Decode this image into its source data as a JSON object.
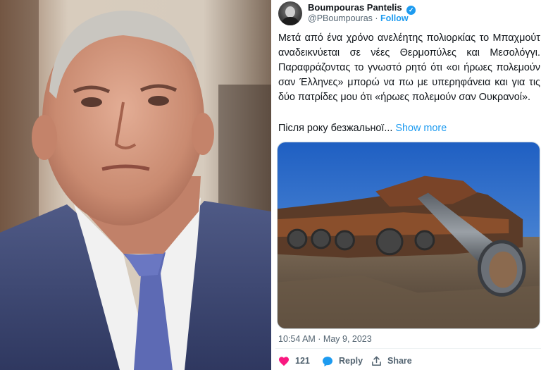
{
  "tweet": {
    "author_name": "Boumpouras Pantelis",
    "author_handle": "@PBoumpouras",
    "separator": "·",
    "follow_label": "Follow",
    "verified_icon": "verified-badge-icon",
    "text": "Μετά από ένα χρόνο ανελέητης πολιορκίας το Μπαχμούτ αναδεικνύεται σε νέες Θερμοπύλες και Μεσολόγγι. Παραφράζοντας το γνωστό ρητό ότι «οι ήρωες πολεμούν σαν Έλληνες» μπορώ να πω με υπερηφάνεια και για τις δύο πατρίδες μου ότι «ήρωες πολεμούν σαν Ουκρανοί».",
    "truncated_text": "Після року безжальної...",
    "show_more_label": "Show more",
    "timestamp": "10:54 AM · May 9, 2023",
    "actions": {
      "like_count": "121",
      "reply_label": "Reply",
      "share_label": "Share"
    }
  },
  "colors": {
    "link": "#1d9bf0",
    "like": "#f91880",
    "text": "#0f1419",
    "muted": "#536471"
  }
}
